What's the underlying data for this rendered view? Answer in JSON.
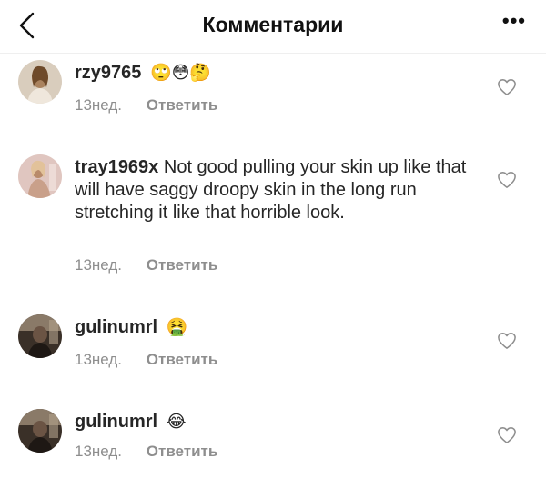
{
  "header": {
    "title": "Комментарии",
    "back_icon": "chevron-left-icon",
    "more_label": "•••"
  },
  "comments": [
    {
      "username": "rzy9765",
      "text": "",
      "emojis": "🙄😳🤔",
      "age": "13нед.",
      "reply_label": "Ответить",
      "like_icon": "heart-icon"
    },
    {
      "username": "tray1969x",
      "text": "Not good pulling your skin up like that will have saggy droopy skin in the long run stretching it like that horrible look.",
      "emojis": "",
      "age": "13нед.",
      "reply_label": "Ответить",
      "like_icon": "heart-icon"
    },
    {
      "username": "gulinumrl",
      "text": "",
      "emojis": "🤮",
      "age": "13нед.",
      "reply_label": "Ответить",
      "like_icon": "heart-icon"
    },
    {
      "username": "gulinumrl",
      "text": "",
      "emojis": "😂",
      "age": "13нед.",
      "reply_label": "Ответить",
      "like_icon": "heart-icon"
    }
  ],
  "colors": {
    "text": "#262626",
    "secondary": "#8e8e8e",
    "divider": "#efefef"
  }
}
